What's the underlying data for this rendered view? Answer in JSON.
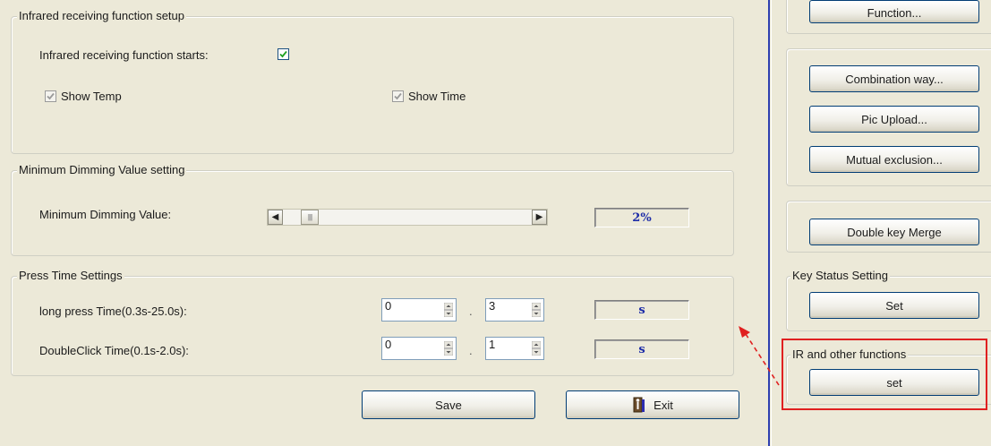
{
  "ir_group": {
    "title": "Infrared receiving function setup",
    "starts_label": "Infrared receiving function starts:",
    "starts_checked": true,
    "show_temp_label": "Show Temp",
    "show_temp_checked": true,
    "show_time_label": "Show Time",
    "show_time_checked": true
  },
  "dimming_group": {
    "title": "Minimum Dimming Value setting",
    "label": "Minimum Dimming Value:",
    "value_display": "2%",
    "slider_percent": 2
  },
  "press_group": {
    "title": "Press Time Settings",
    "long_press_label": "long press Time(0.3s-25.0s):",
    "long_press_int": "0",
    "long_press_dec": "3",
    "long_press_unit": "s",
    "double_click_label": "DoubleClick Time(0.1s-2.0s):",
    "double_click_int": "0",
    "double_click_dec": "1",
    "double_click_unit": "s",
    "separator": "."
  },
  "actions": {
    "save_label": "Save",
    "exit_label": "Exit"
  },
  "right_panel": {
    "function_label": "Function...",
    "combination_label": "Combination way...",
    "pic_upload_label": "Pic Upload...",
    "mutual_exclusion_label": "Mutual exclusion...",
    "double_key_label": "Double key Merge",
    "key_status_title": "Key Status Setting",
    "key_status_set_label": "Set",
    "ir_other_title": "IR and other functions",
    "ir_other_set_label": "set"
  },
  "colors": {
    "highlight_box": "#e02020",
    "value_text": "#1f2ea8",
    "arrow": "#e02020"
  }
}
